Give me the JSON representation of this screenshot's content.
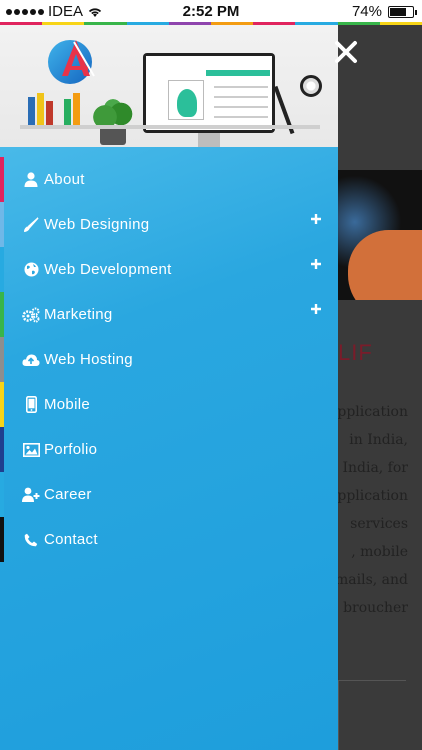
{
  "status_bar": {
    "carrier": "IDEA",
    "time": "2:52 PM",
    "battery": "74%",
    "battery_level": 0.74,
    "signal_bars": 5
  },
  "close_icon": "close-icon",
  "background_page": {
    "headline": "LIF",
    "text_lines": [
      "pplication",
      "in India,",
      "India, for",
      "pplication",
      "services",
      ", mobile",
      "mails, and",
      "broucher"
    ]
  },
  "menu": [
    {
      "label": "About",
      "icon": "user-icon",
      "expandable": false,
      "edge_color": "#e0245e"
    },
    {
      "label": "Web Designing",
      "icon": "paint-brush-icon",
      "expandable": true,
      "edge_color": "#6fb8e8"
    },
    {
      "label": "Web Development",
      "icon": "globe-icon",
      "expandable": true,
      "edge_color": "#27aae1"
    },
    {
      "label": "Marketing",
      "icon": "gears-icon",
      "expandable": true,
      "edge_color": "#38b54a"
    },
    {
      "label": "Web Hosting",
      "icon": "cloud-upload-icon",
      "expandable": false,
      "edge_color": "#8e8e8e"
    },
    {
      "label": "Mobile",
      "icon": "mobile-icon",
      "expandable": false,
      "edge_color": "#f7d417"
    },
    {
      "label": "Porfolio",
      "icon": "image-icon",
      "expandable": false,
      "edge_color": "#1f3f8f"
    },
    {
      "label": "Career",
      "icon": "user-plus-icon",
      "expandable": false,
      "edge_color": "#27aae1"
    },
    {
      "label": "Contact",
      "icon": "phone-icon",
      "expandable": false,
      "edge_color": "#111111"
    }
  ],
  "colors": {
    "drawer_top": "#5ac4ee",
    "drawer_bottom": "#1e9edc",
    "headline": "#7a1c2a"
  }
}
